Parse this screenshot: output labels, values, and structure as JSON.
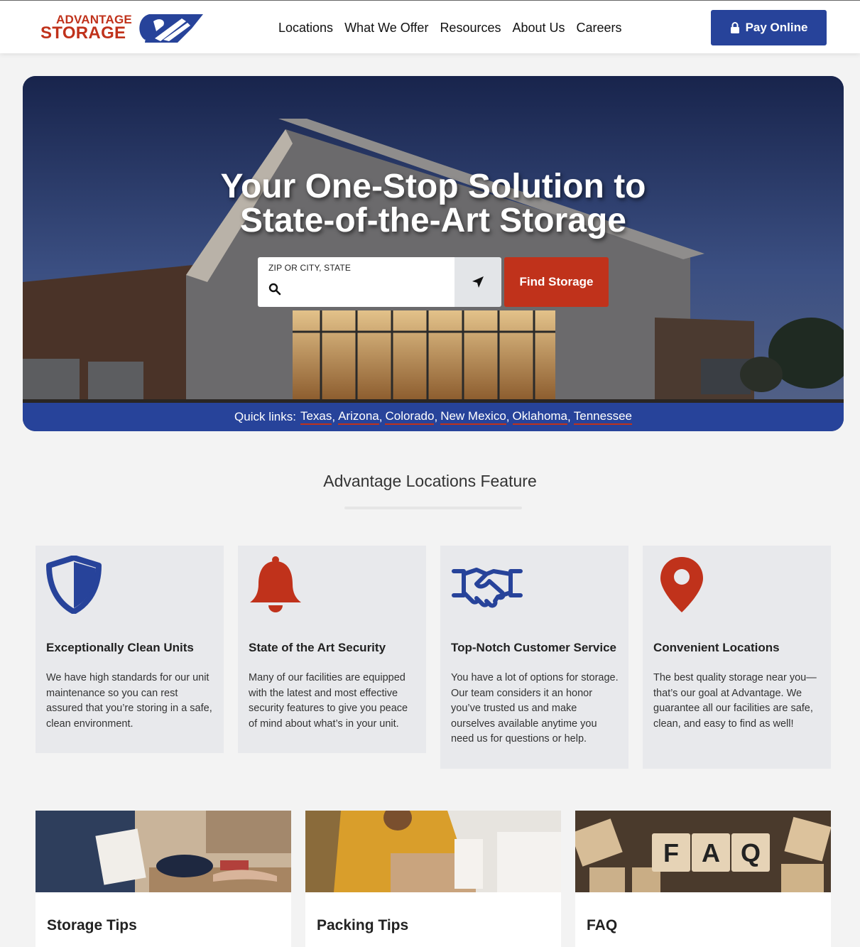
{
  "header": {
    "logo_top": "ADVANTAGE",
    "logo_bottom": "STORAGE",
    "nav": [
      "Locations",
      "What We Offer",
      "Resources",
      "About Us",
      "Careers"
    ],
    "pay_label": "Pay Online"
  },
  "hero": {
    "title_line1": "Your One-Stop Solution to",
    "title_line2": "State-of-the-Art Storage",
    "search_label": "ZIP OR CITY, STATE",
    "search_value": "",
    "find_label": "Find Storage",
    "quick_label": "Quick links:",
    "quick_links": [
      "Texas",
      "Arizona",
      "Colorado",
      "New Mexico",
      "Oklahoma",
      "Tennessee"
    ]
  },
  "features": {
    "heading": "Advantage Locations Feature",
    "cards": [
      {
        "icon": "shield-icon",
        "title": "Exceptionally Clean Units",
        "text": "We have high standards for our unit maintenance so you can rest assured that you’re storing in a safe, clean environment."
      },
      {
        "icon": "bell-icon",
        "title": "State of the Art Security",
        "text": "Many of our facilities are equipped with the latest and most effective security features to give you peace of mind about what’s in your unit."
      },
      {
        "icon": "handshake-icon",
        "title": "Top-Notch Customer Service",
        "text": "You have a lot of options for storage. Our team considers it an honor you’ve trusted us and make ourselves available anytime you need us for questions or help."
      },
      {
        "icon": "map-pin-icon",
        "title": "Convenient Locations",
        "text": "The best quality storage near you—that’s our goal at Advantage. We guarantee all our facilities are safe, clean, and easy to find as well!"
      }
    ]
  },
  "tiles": [
    {
      "title": "Storage Tips"
    },
    {
      "title": "Packing Tips"
    },
    {
      "title": "FAQ",
      "image_text": [
        "F",
        "A",
        "Q"
      ]
    }
  ],
  "colors": {
    "brand_blue": "#27439a",
    "brand_red": "#c0321b"
  }
}
